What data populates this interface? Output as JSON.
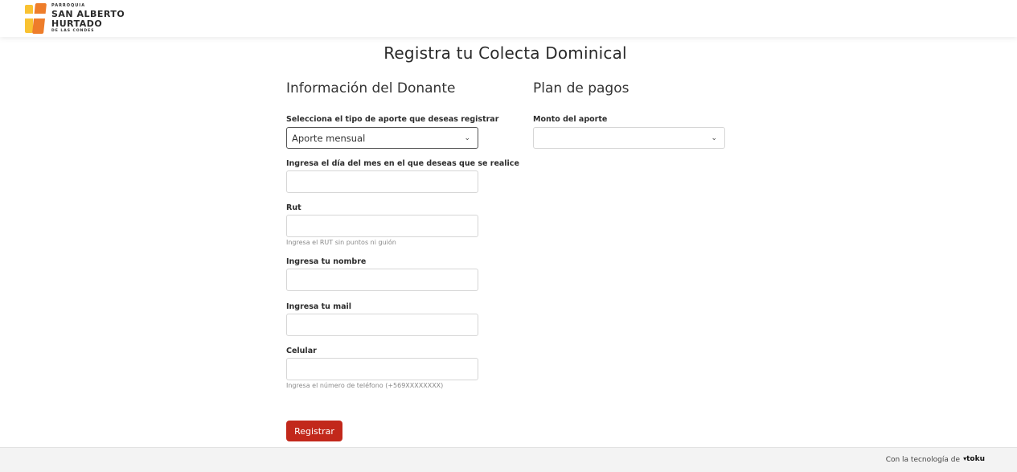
{
  "header": {
    "logo": {
      "line1": "PARROQUIA",
      "line2": "SAN ALBERTO",
      "line3": "HURTADO",
      "line4": "DE LAS CONDES",
      "colors": {
        "yellow": "#f9c232",
        "orange": "#ee7d2a"
      }
    }
  },
  "page_title": "Registra tu Colecta Dominical",
  "donor": {
    "title": "Información del Donante",
    "type": {
      "label": "Selecciona el tipo de aporte que deseas registrar",
      "value": "Aporte mensual"
    },
    "day": {
      "label": "Ingresa el día del mes en el que deseas que se realice",
      "value": ""
    },
    "rut": {
      "label": "Rut",
      "value": "",
      "hint": "Ingresa el RUT sin puntos ni guión"
    },
    "name": {
      "label": "Ingresa tu nombre",
      "value": ""
    },
    "mail": {
      "label": "Ingresa tu mail",
      "value": ""
    },
    "phone": {
      "label": "Celular",
      "value": "",
      "hint": "Ingresa el número de teléfono (+569XXXXXXXX)"
    },
    "submit_label": "Registrar"
  },
  "plan": {
    "title": "Plan de pagos",
    "amount": {
      "label": "Monto del aporte",
      "value": ""
    }
  },
  "footer": {
    "text": "Con la tecnología de",
    "brand": "toku"
  },
  "colors": {
    "accent": "#c2281b"
  },
  "icons": {
    "dropdown": "chevron-down-icon",
    "brand": "toku-logo-icon"
  }
}
